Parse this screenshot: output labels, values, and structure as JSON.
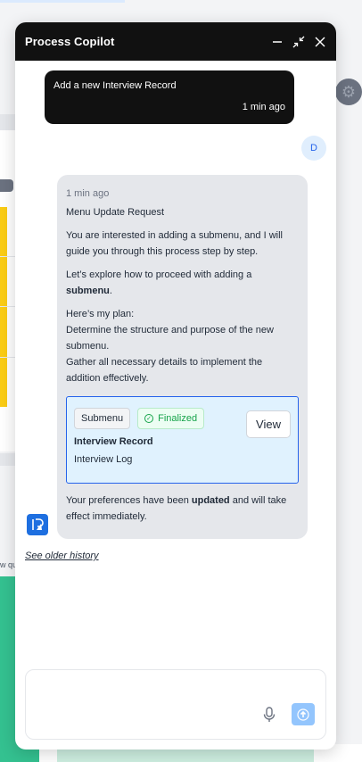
{
  "background": {
    "truncated_text": "w qu"
  },
  "copilot": {
    "title": "Process Copilot",
    "header_icons": [
      "minimize-icon",
      "collapse-icon",
      "close-icon"
    ],
    "user_message": {
      "text": "Add a new Interview Record",
      "time": "1 min ago",
      "avatar_initial": "D"
    },
    "bot_message": {
      "time": "1 min ago",
      "heading": "Menu Update Request",
      "intro": "You are interested in adding a submenu, and I will guide you through this process step by step.",
      "explore_prefix": "Let’s explore how to proceed with adding a",
      "explore_bold": "submenu",
      "explore_suffix": ".",
      "plan_heading": "Here’s my plan:",
      "plan_step_1": "Determine the structure and purpose of the new submenu.",
      "plan_step_2": "Gather all necessary details to implement the addition effectively.",
      "card": {
        "type_tag": "Submenu",
        "status_tag": "Finalized",
        "title": "Interview Record",
        "subtitle": "Interview Log",
        "view_label": "View"
      },
      "footer_prefix": "Your preferences have been",
      "footer_bold": "updated",
      "footer_suffix": "and will take effect immediately."
    },
    "older_history_label": "See older history",
    "composer": {
      "placeholder": "",
      "value": ""
    }
  },
  "colors": {
    "header_bg": "#111111",
    "accent_blue": "#2563eb",
    "finalized_green": "#16a34a",
    "card_bg": "#e0f2fe",
    "send_button": "#93c5fd"
  }
}
